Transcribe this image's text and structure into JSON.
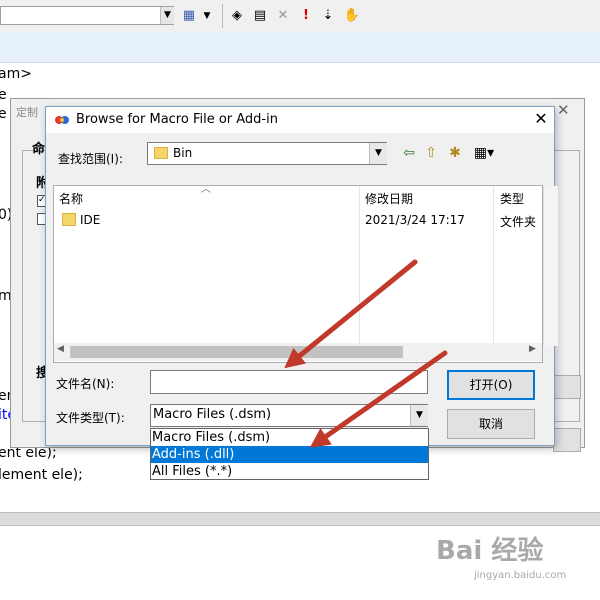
{
  "background": {
    "code_lines": [
      "am>",
      "e",
      "e s",
      "0)",
      "me",
      "en",
      "ite",
      "ent ele);",
      "lement ele);"
    ],
    "customize_title": "定制",
    "customize_tab": "命",
    "customize_tab2": "附",
    "customize_label": "搜",
    "watermark": "Bai 经验",
    "watermark_url": "jingyan.baidu.com"
  },
  "dialog": {
    "title": "Browse for Macro File or Add-in",
    "look_in_label": "查找范围(I):",
    "look_in_value": "Bin",
    "columns": {
      "name": "名称",
      "date": "修改日期",
      "type": "类型"
    },
    "files": [
      {
        "name": "IDE",
        "date": "2021/3/24 17:17",
        "type": "文件夹"
      }
    ],
    "filename_label": "文件名(N):",
    "filename_value": "",
    "filetype_label": "文件类型(T):",
    "filetype_value": "Macro Files (.dsm)",
    "filetype_options": [
      "Macro Files (.dsm)",
      "Add-ins (.dll)",
      "All Files (*.*)"
    ],
    "selected_option_index": 1,
    "open_button": "打开(O)",
    "cancel_button": "取消"
  },
  "icons": [
    "dropdown-arrow-icon",
    "toolbar-icons",
    "back-arrow-icon",
    "up-folder-icon",
    "new-folder-icon",
    "view-menu-icon",
    "folder-icon",
    "close-icon"
  ],
  "colors": {
    "selection": "#0078d7",
    "arrow": "#c0392b",
    "folder": "#f5d46b",
    "code_blue": "#0000ff"
  }
}
